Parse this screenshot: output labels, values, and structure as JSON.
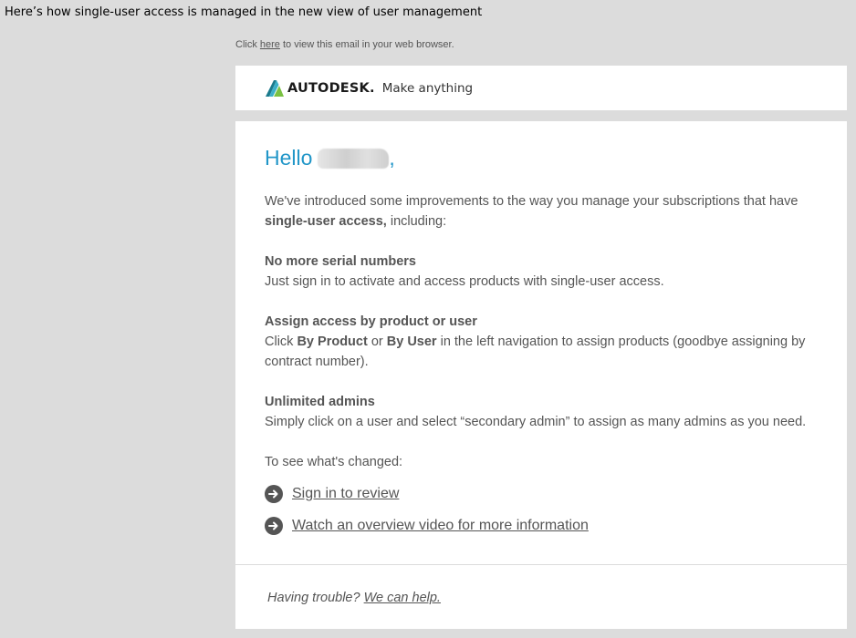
{
  "caption": "Here’s how single-user access is managed in the new view of user management",
  "browser_line": {
    "prefix": "Click ",
    "link": "here",
    "suffix": " to view this email in your web browser."
  },
  "header": {
    "logo_text": "AUTODESK.",
    "tagline": "Make anything"
  },
  "greeting": {
    "hello": "Hello",
    "punct": ","
  },
  "intro": {
    "text": "We've introduced some improvements to the way you manage your subscriptions that have ",
    "bold": "single-user access,",
    "tail": " including:"
  },
  "features": [
    {
      "heading": "No more serial numbers",
      "body": "Just sign in to activate and access products with single-user access."
    },
    {
      "heading": "Assign access by product or user",
      "body_pre": "Click ",
      "bold1": "By Product",
      "mid": " or ",
      "bold2": "By User",
      "body_post": " in the left navigation to assign products (goodbye assigning by contract number)."
    },
    {
      "heading": "Unlimited admins",
      "body": "Simply click on a user and select “secondary admin” to assign as many admins as you need."
    }
  ],
  "see_changed": "To see what's changed:",
  "links": [
    "Sign in to review",
    "Watch an overview video for more information"
  ],
  "footer": {
    "prefix": "Having trouble? ",
    "link": "We can help."
  },
  "colors": {
    "greeting": "#2196c8",
    "background": "#dcdcdc",
    "text": "#555555"
  },
  "icons": {
    "link_bullet": "arrow-right-circle-icon",
    "logo": "autodesk-logo-icon"
  }
}
